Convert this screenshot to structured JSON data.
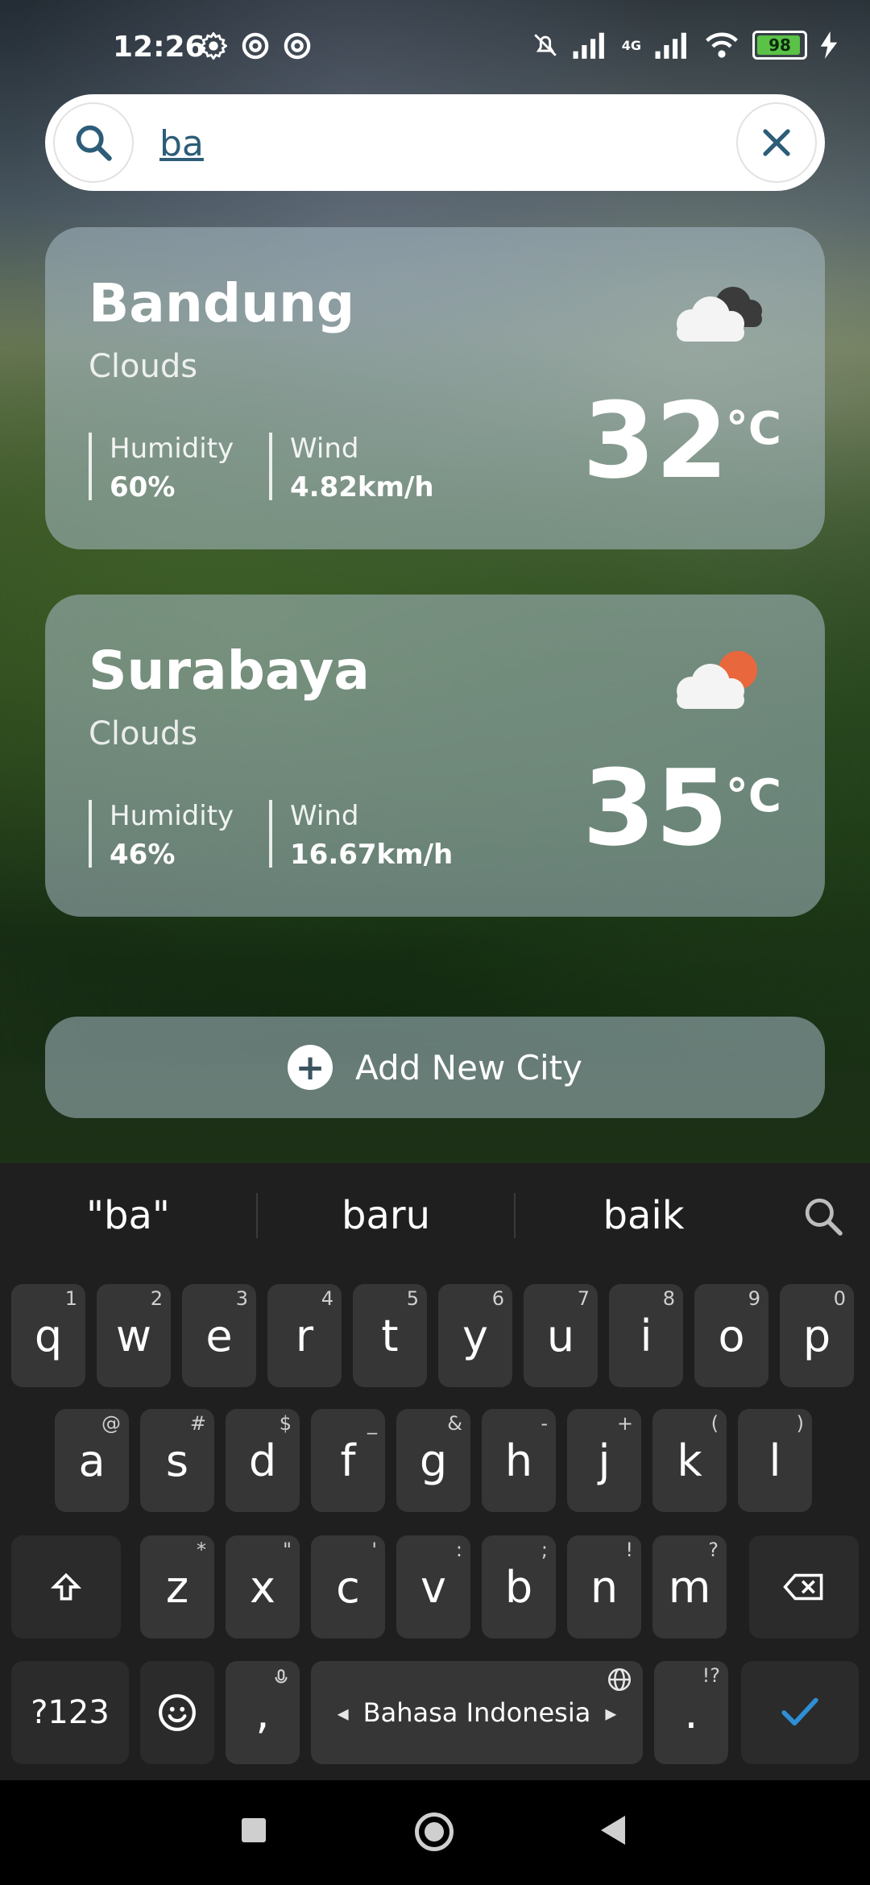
{
  "status_bar": {
    "time": "12:26",
    "battery": "98",
    "network": "4G"
  },
  "search": {
    "value": "ba",
    "placeholder": ""
  },
  "cards": [
    {
      "city": "Bandung",
      "condition": "Clouds",
      "humidity_label": "Humidity",
      "humidity": "60%",
      "wind_label": "Wind",
      "wind": "4.82km/h",
      "temp": "32",
      "unit": "°C",
      "icon": "cloud-dark-icon"
    },
    {
      "city": "Surabaya",
      "condition": "Clouds",
      "humidity_label": "Humidity",
      "humidity": "46%",
      "wind_label": "Wind",
      "wind": "16.67km/h",
      "temp": "35",
      "unit": "°C",
      "icon": "cloud-sun-icon"
    }
  ],
  "add_city": {
    "label": "Add New City"
  },
  "keyboard": {
    "suggestions": [
      "\"ba\"",
      "baru",
      "baik"
    ],
    "row1": [
      "q",
      "w",
      "e",
      "r",
      "t",
      "y",
      "u",
      "i",
      "o",
      "p"
    ],
    "row1_hints": [
      "1",
      "2",
      "3",
      "4",
      "5",
      "6",
      "7",
      "8",
      "9",
      "0"
    ],
    "row2": [
      "a",
      "s",
      "d",
      "f",
      "g",
      "h",
      "j",
      "k",
      "l"
    ],
    "row2_hints": [
      "@",
      "#",
      "$",
      "_",
      "&",
      "-",
      "+",
      "(",
      ")"
    ],
    "row3": [
      "z",
      "x",
      "c",
      "v",
      "b",
      "n",
      "m"
    ],
    "row3_hints": [
      "*",
      "\"",
      "'",
      ":",
      ";",
      "!",
      "?"
    ],
    "sym_label": "?123",
    "comma": ",",
    "period": ".",
    "period_hint": "!?",
    "space_label": "Bahasa Indonesia",
    "colors": {
      "key_bg": "#363636",
      "kb_bg": "#1f1f1f",
      "enter_check": "#2e8fd6"
    }
  }
}
